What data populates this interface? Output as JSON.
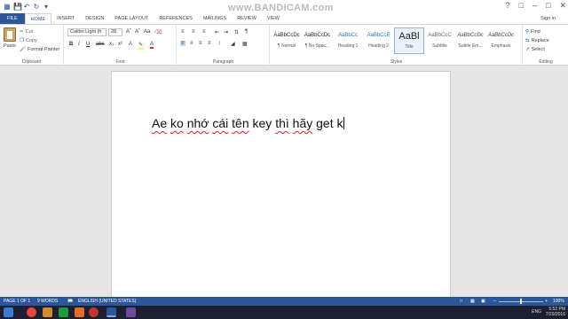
{
  "watermark": "www.BANDICAM.com",
  "tabs": {
    "file": "FILE",
    "home": "HOME",
    "insert": "INSERT",
    "design": "DESIGN",
    "page_layout": "PAGE LAYOUT",
    "references": "REFERENCES",
    "mailings": "MAILINGS",
    "review": "REVIEW",
    "view": "VIEW"
  },
  "sign_in": "Sign in",
  "clipboard": {
    "paste": "Paste",
    "cut": "Cut",
    "copy": "Copy",
    "format_painter": "Format Painter",
    "label": "Clipboard"
  },
  "font": {
    "name": "Calibri Light (h",
    "size": "28",
    "label": "Font"
  },
  "paragraph": {
    "label": "Paragraph"
  },
  "styles": {
    "label": "Styles",
    "items": [
      {
        "preview": "AaBbCcDc",
        "name": "¶ Normal"
      },
      {
        "preview": "AaBbCcDc",
        "name": "¶ No Spac..."
      },
      {
        "preview": "AaBbCc",
        "name": "Heading 1"
      },
      {
        "preview": "AaBbCcE",
        "name": "Heading 2"
      },
      {
        "preview": "AaBl",
        "name": "Title"
      },
      {
        "preview": "AaBbCcC",
        "name": "Subtitle"
      },
      {
        "preview": "AaBbCcDc",
        "name": "Subtle Em..."
      },
      {
        "preview": "AaBbCcDc",
        "name": "Emphasis"
      }
    ]
  },
  "editing": {
    "find": "Find",
    "replace": "Replace",
    "select": "Select",
    "label": "Editing"
  },
  "document": {
    "words": [
      "Ae",
      "ko",
      "nhớ",
      "cái",
      "tên",
      "key",
      "thì",
      "hãy",
      "get",
      "k"
    ]
  },
  "status": {
    "page": "PAGE 1 OF 1",
    "words": "9 WORDS",
    "language": "ENGLISH (UNITED STATES)",
    "zoom": "100%"
  },
  "tray": {
    "lang": "ENG",
    "time": "5:52 PM",
    "date": "7/29/2016"
  }
}
